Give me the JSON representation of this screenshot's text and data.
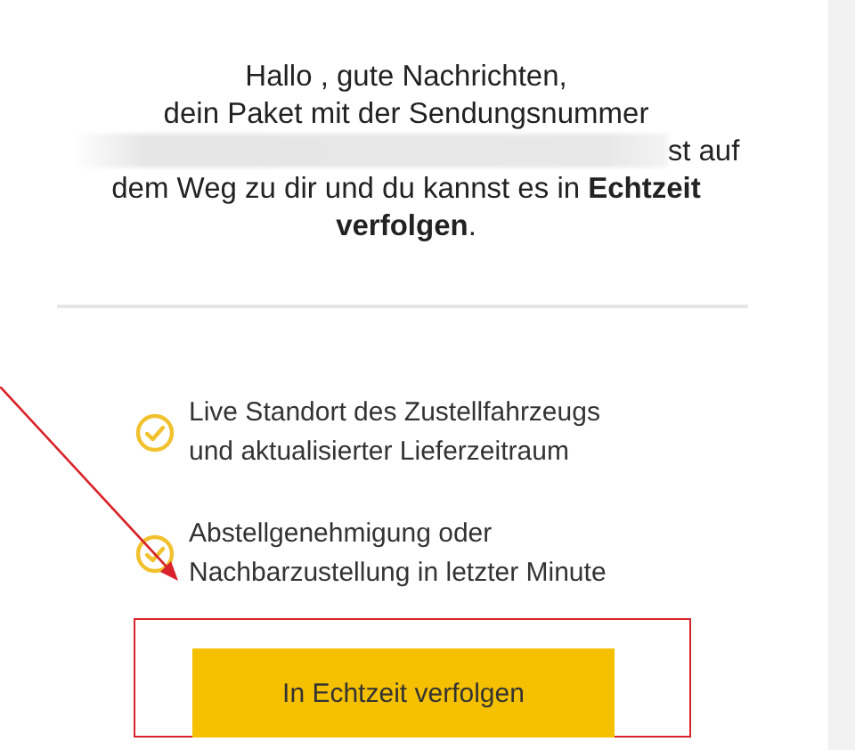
{
  "message": {
    "intro": "Hallo , gute Nachrichten,\ndein Paket mit der Sendungsnummer",
    "redacted": true,
    "rest": "st auf dem Weg zu dir und du kannst es in **Echtzeit verfolgen**."
  },
  "features": [
    {
      "text": "Live Standort des Zustellfahrzeugs und aktualisierter Lieferzeitraum"
    },
    {
      "text": "Abstellgenehmigung oder Nachbarzustellung in letzter Minute"
    }
  ],
  "button": {
    "label": "In Echtzeit verfolgen"
  },
  "annotations": {
    "arrow": true,
    "frame": true
  }
}
